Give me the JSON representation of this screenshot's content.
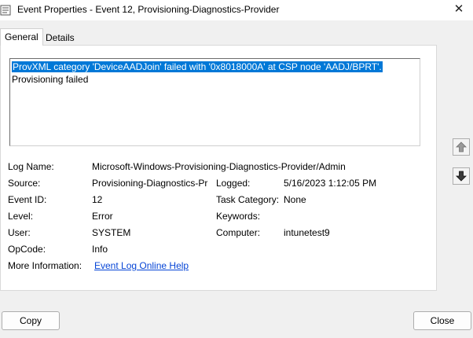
{
  "window": {
    "title": "Event Properties - Event 12, Provisioning-Diagnostics-Provider",
    "close_glyph": "✕"
  },
  "tabs": {
    "general": "General",
    "details": "Details"
  },
  "description": {
    "line1": "ProvXML category 'DeviceAADJoin' failed with '0x8018000A' at CSP node 'AADJ/BPRT'.",
    "line2": "Provisioning failed"
  },
  "fields": {
    "log_name_label": "Log Name:",
    "log_name": "Microsoft-Windows-Provisioning-Diagnostics-Provider/Admin",
    "source_label": "Source:",
    "source": "Provisioning-Diagnostics-Pr",
    "logged_label": "Logged:",
    "logged": "5/16/2023 1:12:05 PM",
    "event_id_label": "Event ID:",
    "event_id": "12",
    "task_category_label": "Task Category:",
    "task_category": "None",
    "level_label": "Level:",
    "level": "Error",
    "keywords_label": "Keywords:",
    "keywords": "",
    "user_label": "User:",
    "user": "SYSTEM",
    "computer_label": "Computer:",
    "computer": "intunetest9",
    "opcode_label": "OpCode:",
    "opcode": "Info",
    "more_info_label": "More Information:",
    "more_info_link": "Event Log Online Help"
  },
  "buttons": {
    "copy": "Copy",
    "close": "Close"
  },
  "icons": {
    "app": "event-viewer-icon",
    "up": "arrow-up-icon",
    "down": "arrow-down-icon"
  },
  "colors": {
    "selection": "#0078d7",
    "link": "#0645d6"
  }
}
